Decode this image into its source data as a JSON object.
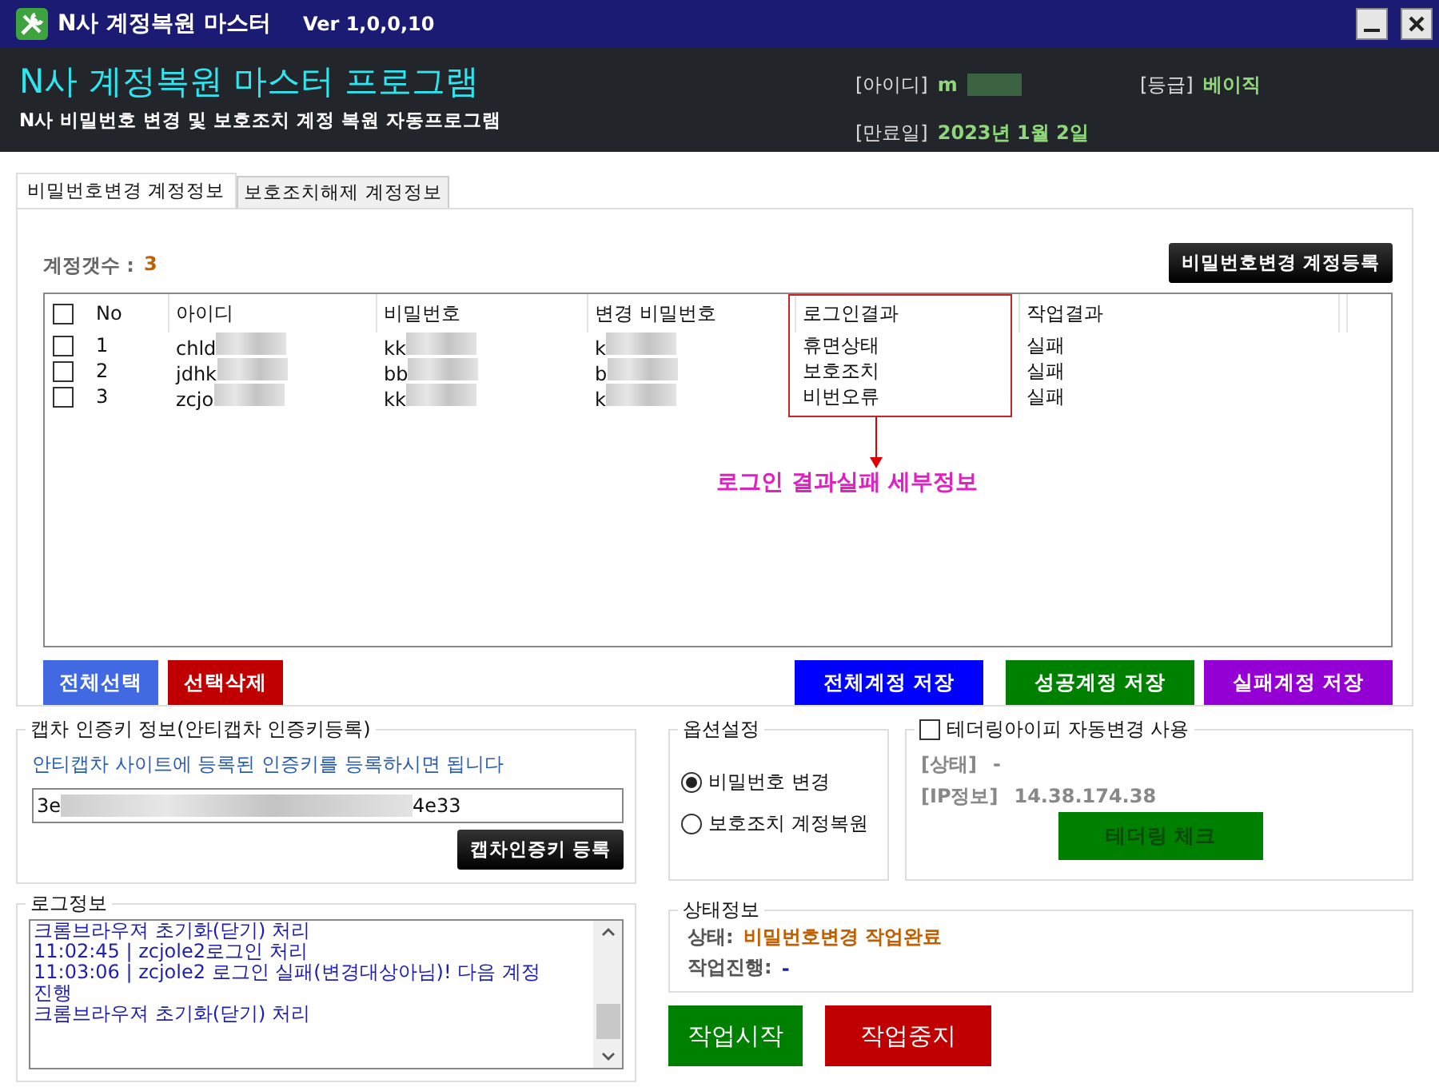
{
  "window": {
    "title": "N사 계정복원 마스터",
    "version": "Ver 1,0,0,10"
  },
  "header": {
    "title": "N사 계정복원 마스터 프로그램",
    "subtitle": "N사 비밀번호 변경 및 보호조치 계정 복원 자동프로그램",
    "fields": [
      {
        "label": "[아이디]",
        "value": "m",
        "masked": true
      },
      {
        "label": "[등급]",
        "value": "베이직",
        "masked": false
      },
      {
        "label": "[만료일]",
        "value": "2023년 1월 2일",
        "masked": false
      }
    ]
  },
  "tabs": [
    {
      "label": "비밀번호변경 계정정보",
      "selected": true
    },
    {
      "label": "보호조치해제 계정정보",
      "selected": false
    }
  ],
  "account_count": {
    "label": "계정갯수 :",
    "value": "3"
  },
  "register_button": "비밀번호변경 계정등록",
  "table": {
    "header_checked": false,
    "columns": [
      {
        "label": "No",
        "masked": false,
        "highlighted": false
      },
      {
        "label": "아이디",
        "masked": true,
        "highlighted": false
      },
      {
        "label": "비밀번호",
        "masked": true,
        "highlighted": false
      },
      {
        "label": "변경 비밀번호",
        "masked": true,
        "highlighted": false
      },
      {
        "label": "로그인결과",
        "masked": false,
        "highlighted": true
      },
      {
        "label": "작업결과",
        "masked": false,
        "highlighted": false
      }
    ],
    "rows": [
      {
        "checked": false,
        "cells": [
          "1",
          "chld",
          "kk",
          "k",
          "휴면상태",
          "실패"
        ]
      },
      {
        "checked": false,
        "cells": [
          "2",
          "jdhk",
          "bb",
          "b",
          "보호조치",
          "실패"
        ]
      },
      {
        "checked": false,
        "cells": [
          "3",
          "zcjo",
          "kk",
          "k",
          "비번오류",
          "실패"
        ]
      }
    ]
  },
  "annotation": "로그인 결과실패 세부정보",
  "list_buttons": [
    {
      "label": "전체선택",
      "color": "#4169e1"
    },
    {
      "label": "선택삭제",
      "color": "#c00000"
    }
  ],
  "save_buttons": [
    {
      "label": "전체계정 저장",
      "color": "#0000ff"
    },
    {
      "label": "성공계정 저장",
      "color": "#008000"
    },
    {
      "label": "실패계정 저장",
      "color": "#9400d3"
    }
  ],
  "captcha": {
    "title": "캡차 인증키 정보(안티캡차 인증키등록)",
    "hint": "안티캡차 사이트에 등록된 인증키를 등록하시면 됩니다",
    "key_start": "3e",
    "key_end": "4e33",
    "button": "캡차인증키 등록"
  },
  "options": {
    "title": "옵션설정",
    "choices": [
      {
        "label": "비밀번호 변경",
        "selected": true
      },
      {
        "label": "보호조치 계정복원",
        "selected": false
      }
    ]
  },
  "tethering": {
    "label": "테더링아이피 자동변경 사용",
    "checked": false,
    "state_label": "[상태]",
    "state_value": "-",
    "ip_label": "[IP정보]",
    "ip_value": "14.38.174.38",
    "button": "테더링 체크"
  },
  "log": {
    "title": "로그정보",
    "lines": [
      "크롬브라우져 초기화(닫기) 처리",
      "11:02:45 | zcjole2로그인 처리",
      "11:03:06 | zcjole2 로그인 실패(변경대상아님)! 다음 계정진행",
      "크롬브라우져 초기화(닫기) 처리"
    ]
  },
  "status": {
    "title": "상태정보",
    "state_label": "상태:",
    "state_value": "비밀번호변경 작업완료",
    "progress_label": "작업진행:",
    "progress_value": "-"
  },
  "actions": [
    {
      "label": "작업시작",
      "color": "#008000"
    },
    {
      "label": "작업중지",
      "color": "#c00000"
    }
  ]
}
